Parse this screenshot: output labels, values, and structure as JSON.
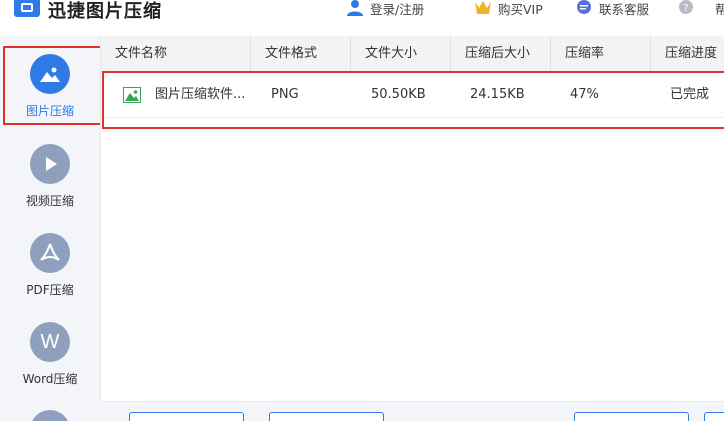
{
  "app": {
    "title": "迅捷图片压缩"
  },
  "topbar": {
    "login": "登录/注册",
    "vip": "购买VIP",
    "support": "联系客服",
    "help": "帮"
  },
  "sidebar": {
    "items": [
      {
        "label": "图片压缩",
        "active": true
      },
      {
        "label": "视频压缩",
        "active": false
      },
      {
        "label": "PDF压缩",
        "active": false
      },
      {
        "label": "Word压缩",
        "active": false
      }
    ]
  },
  "table": {
    "columns": [
      "文件名称",
      "文件格式",
      "文件大小",
      "压缩后大小",
      "压缩率",
      "压缩进度"
    ],
    "rows": [
      {
        "name": "图片压缩软件...",
        "format": "PNG",
        "size": "50.50KB",
        "compressed": "24.15KB",
        "rate": "47%",
        "progress": "已完成"
      }
    ]
  },
  "colors": {
    "accent": "#2f7ae6",
    "highlight": "#e0312f",
    "sidebar_bg": "#f4f5f8"
  }
}
